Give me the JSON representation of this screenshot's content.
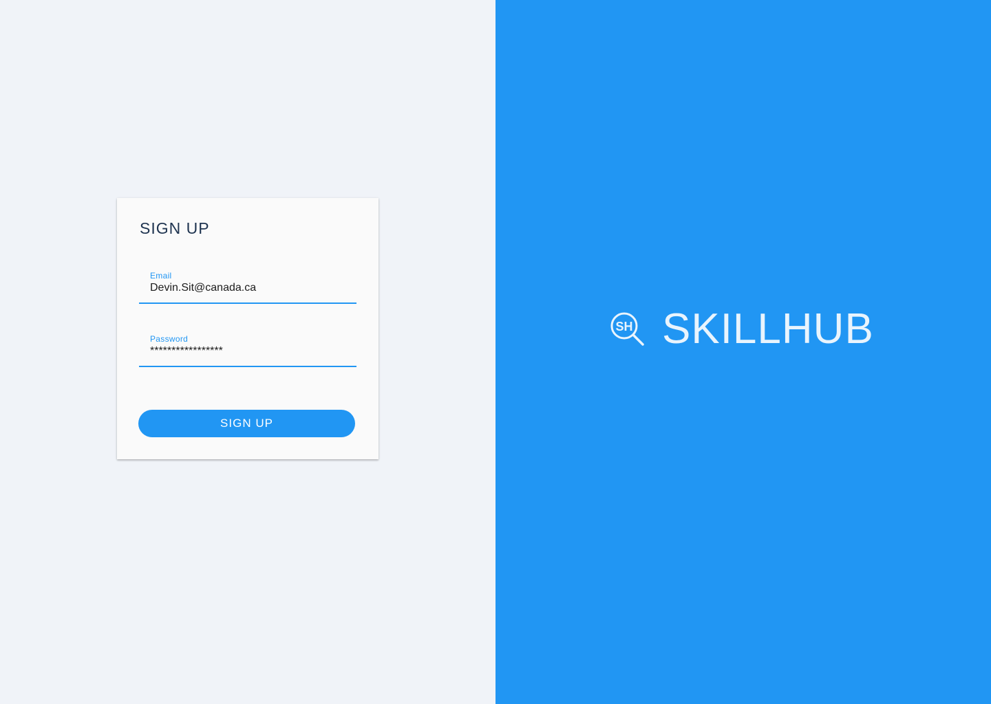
{
  "signup_form": {
    "title": "SIGN UP",
    "email": {
      "label": "Email",
      "value": "Devin.Sit@canada.ca"
    },
    "password": {
      "label": "Password",
      "value": "*****************"
    },
    "submit_label": "SIGN UP"
  },
  "brand": {
    "logo_letters": "SH",
    "name": "SKILLHUB",
    "icon": "magnifier-logo-icon"
  },
  "colors": {
    "accent": "#2196f3",
    "left_background": "#f0f3f8",
    "card_background": "#fafafa",
    "title_text": "#1f3450",
    "brand_text": "#e9f4fd"
  }
}
